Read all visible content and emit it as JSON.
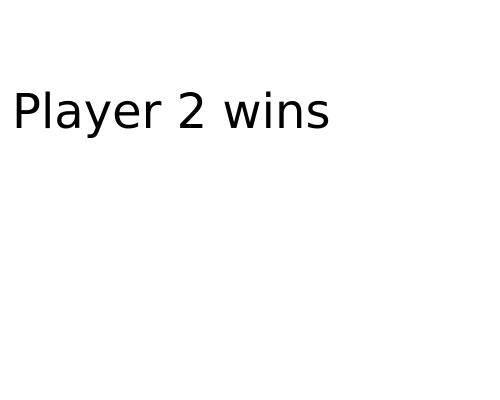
{
  "game": {
    "result_message": "Player 2 wins"
  },
  "colors": {
    "background": "#ffffff",
    "text": "#000000"
  }
}
